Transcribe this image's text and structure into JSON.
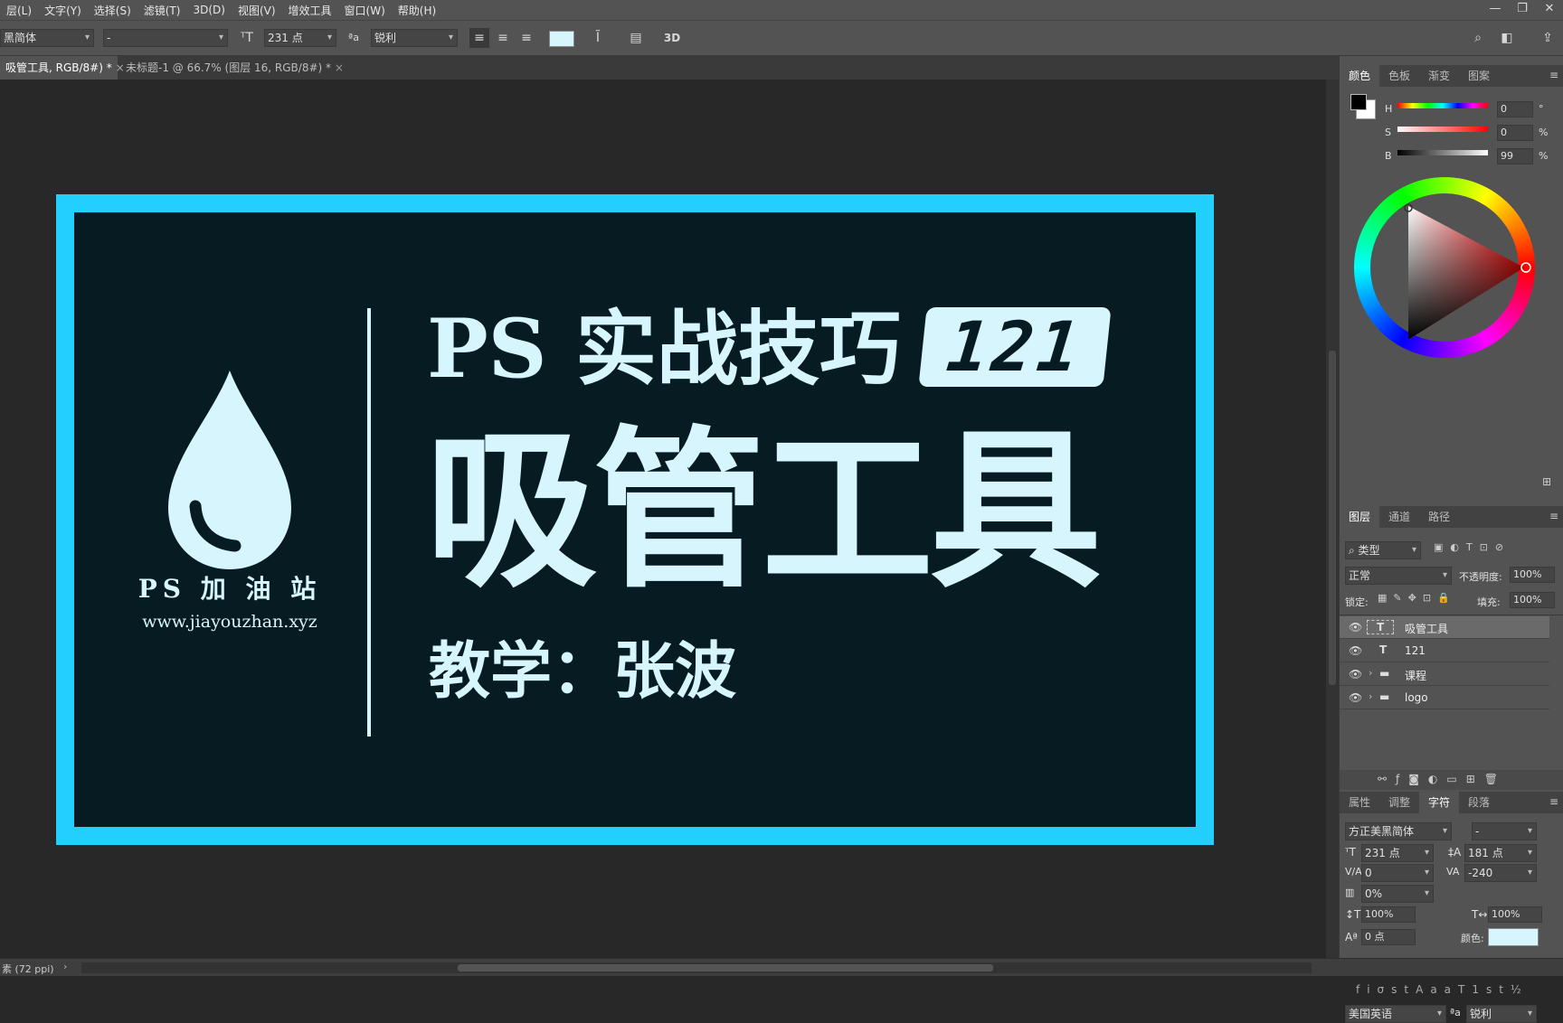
{
  "menu": [
    "层(L)",
    "文字(Y)",
    "选择(S)",
    "滤镜(T)",
    "3D(D)",
    "视图(V)",
    "增效工具",
    "窗口(W)",
    "帮助(H)"
  ],
  "window_controls": {
    "minimize": "—",
    "restore": "❐",
    "close": "✕"
  },
  "options": {
    "font_family": "黑简体",
    "font_style": "-",
    "font_size": "231 点",
    "aa_icon_label": "ªa",
    "antialias": "锐利",
    "swatch_color": "#d7f5fd"
  },
  "tabs": [
    {
      "label": "吸管工具, RGB/8#) *",
      "active": true
    },
    {
      "label": "未标题-1 @ 66.7% (图层 16, RGB/8#) *",
      "active": false
    }
  ],
  "artwork": {
    "border_color": "#23cfff",
    "bg_color": "#071b22",
    "text_color": "#d7f5fd",
    "logo_name": "PS 加 油 站",
    "logo_url": "www.jiayouzhan.xyz",
    "line1": "PS 实战技巧",
    "badge": "121",
    "title": "吸管工具",
    "teacher": "教学：张波"
  },
  "color_panel": {
    "tabs": [
      "颜色",
      "色板",
      "渐变",
      "图案"
    ],
    "h_label": "H",
    "h": "0",
    "h_unit": "°",
    "s_label": "S",
    "s": "0",
    "s_unit": "%",
    "b_label": "B",
    "b": "99",
    "b_unit": "%"
  },
  "layers_panel": {
    "tabs": [
      "图层",
      "通道",
      "路径"
    ],
    "filter": "类型",
    "blend": "正常",
    "opacity_label": "不透明度:",
    "opacity": "100%",
    "lock_label": "锁定:",
    "fill_label": "填充:",
    "fill": "100%",
    "layers": [
      {
        "name": "吸管工具",
        "kind": "text",
        "selected": true
      },
      {
        "name": "121",
        "kind": "text",
        "selected": false
      },
      {
        "name": "课程",
        "kind": "group",
        "selected": false
      },
      {
        "name": "logo",
        "kind": "group",
        "selected": false
      }
    ]
  },
  "char_panel": {
    "tabs": [
      "属性",
      "调整",
      "字符",
      "段落"
    ],
    "font": "方正美黑简体",
    "style": "-",
    "size": "231 点",
    "leading": "181 点",
    "kerning": "0",
    "tracking": "-240",
    "tsume": "0%",
    "vscale": "100%",
    "hscale": "100%",
    "baseline": "0 点",
    "color_label": "颜色:",
    "language": "美国英语",
    "antialias": "锐利"
  },
  "status": {
    "text": "素 (72 ppi)"
  }
}
